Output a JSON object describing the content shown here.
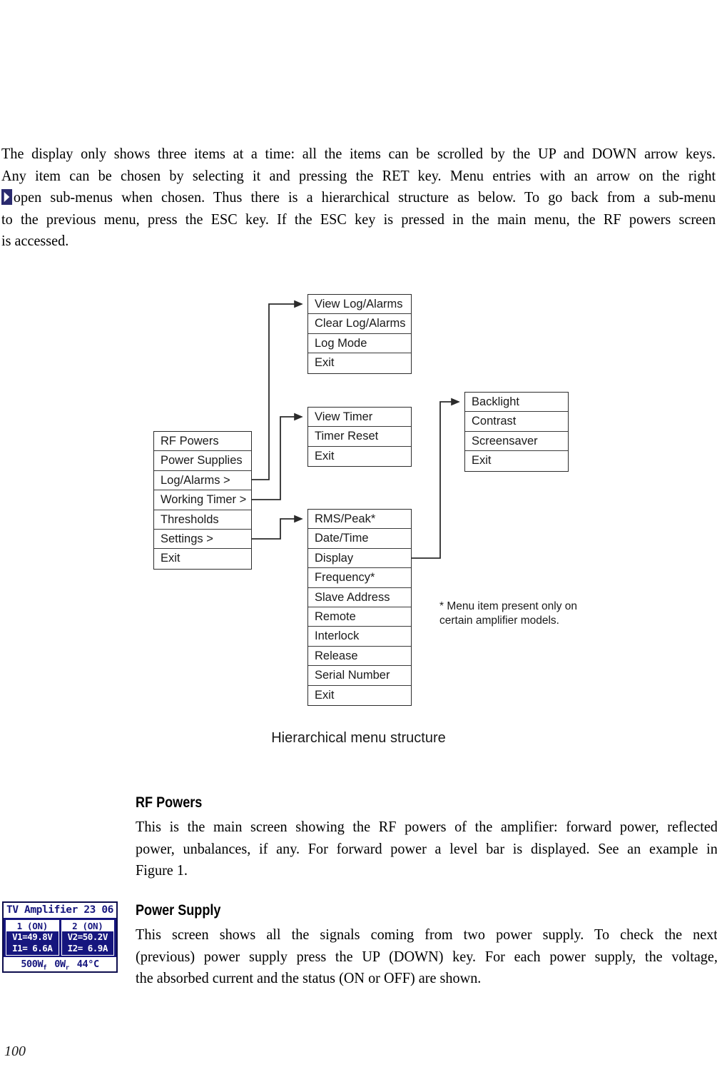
{
  "page_number": "100",
  "intro_paragraph": {
    "lines": [
      "The display only shows three items at a time: all the items can be scrolled by the UP and DOWN arrow keys.",
      "Any item can be chosen by selecting it and pressing the RET key. Menu entries with an arrow on the right",
      "open sub-menus when chosen. Thus there is a hierarchical structure as below. To go back from a sub-menu",
      "to the previous menu, press the ESC key. If the ESC key is pressed in the main menu, the RF powers screen",
      "is accessed."
    ],
    "arrow_icon": "right-arrow-glyph"
  },
  "diagram": {
    "caption": "Hierarchical menu structure",
    "footnote": "* Menu item present only on certain amplifier models.",
    "boxes": {
      "main_menu": {
        "name": "main-menu",
        "items": [
          "RF Powers",
          "Power Supplies",
          "Log/Alarms >",
          "Working Timer >",
          "Thresholds",
          "Settings >",
          "Exit"
        ]
      },
      "log_alarms_menu": {
        "name": "log-alarms-submenu",
        "items": [
          "View Log/Alarms",
          "Clear Log/Alarms",
          "Log Mode",
          "Exit"
        ]
      },
      "working_timer_menu": {
        "name": "working-timer-submenu",
        "items": [
          "View Timer",
          "Timer Reset",
          "Exit"
        ]
      },
      "settings_menu": {
        "name": "settings-submenu",
        "items": [
          "RMS/Peak*",
          "Date/Time",
          "Display",
          "Frequency*",
          "Slave Address",
          "Remote",
          "Interlock",
          "Release",
          "Serial Number",
          "Exit"
        ]
      },
      "display_menu": {
        "name": "display-submenu",
        "items": [
          "Backlight",
          "Contrast",
          "Screensaver",
          "Exit"
        ]
      }
    }
  },
  "sections": [
    {
      "heading": "RF Powers",
      "lines": [
        "This is the main screen showing the RF powers of the amplifier: forward power, reflected",
        "power, unbalances, if any. For forward power a level bar is displayed. See an example in",
        "Figure 1."
      ]
    },
    {
      "heading": "Power Supply",
      "lines": [
        "This screen shows all the signals coming from two power supply. To check the next",
        "(previous) power supply press the UP (DOWN) key. For each power supply, the voltage,",
        "the absorbed current and the status (ON or OFF) are shown."
      ]
    }
  ],
  "lcd_screenshot": {
    "title": "TV Amplifier",
    "time": "23 06",
    "psu1": {
      "header": "1 (ON)",
      "voltage": "V1=49.8V",
      "current": "I1= 6.6A"
    },
    "psu2": {
      "header": "2 (ON)",
      "voltage": "V2=50.2V",
      "current": "I2= 6.9A"
    },
    "footer": {
      "forward": "500W",
      "forward_sub": "f",
      "reflected": "0W",
      "reflected_sub": "r",
      "temperature": "44°C"
    },
    "colors": {
      "background": "#16167e",
      "foreground": "#ffffff"
    }
  }
}
